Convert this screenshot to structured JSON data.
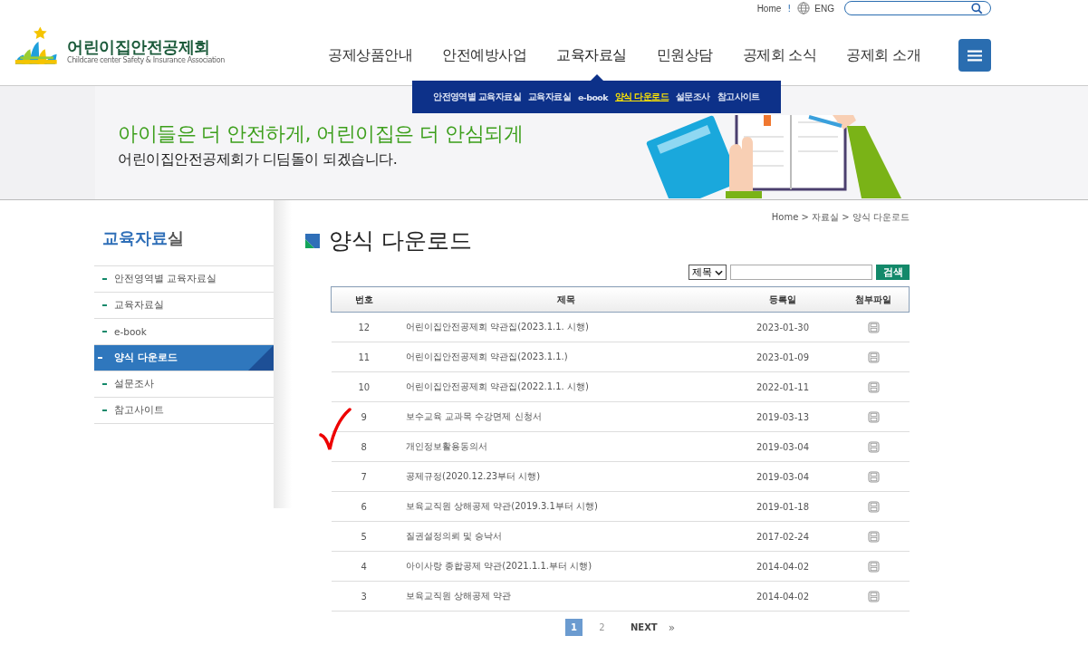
{
  "utility": {
    "home": "Home",
    "separator": "!",
    "language": "ENG"
  },
  "logo": {
    "name": "어린이집안전공제회",
    "subtitle": "Childcare center Safety & Insurance Association"
  },
  "nav": [
    {
      "label": "공제상품안내",
      "selected": false
    },
    {
      "label": "안전예방사업",
      "selected": false
    },
    {
      "label": "교육자료실",
      "selected": true
    },
    {
      "label": "민원상담",
      "selected": false
    },
    {
      "label": "공제회 소식",
      "selected": false
    },
    {
      "label": "공제회 소개",
      "selected": false
    }
  ],
  "submenu": [
    {
      "label": "안전영역별 교육자료실",
      "selected": false
    },
    {
      "label": "교육자료실",
      "selected": false
    },
    {
      "label": "e-book",
      "selected": false
    },
    {
      "label": "양식 다운로드",
      "selected": true
    },
    {
      "label": "설문조사",
      "selected": false
    },
    {
      "label": "참고사이트",
      "selected": false
    }
  ],
  "banner": {
    "headline": "아이들은 더 안전하게, 어린이집은 더 안심되게",
    "subline": "어린이집안전공제회가 디딤돌이 되겠습니다."
  },
  "sidebar": {
    "title_main": "교육자료",
    "title_suffix": "실",
    "items": [
      {
        "label": "안전영역별 교육자료실",
        "selected": false
      },
      {
        "label": "교육자료실",
        "selected": false
      },
      {
        "label": "e-book",
        "selected": false
      },
      {
        "label": "양식 다운로드",
        "selected": true
      },
      {
        "label": "설문조사",
        "selected": false
      },
      {
        "label": "참고사이트",
        "selected": false
      }
    ]
  },
  "breadcrumb": "Home > 자료실 > 양식 다운로드",
  "page_title": "양식 다운로드",
  "search": {
    "field": "제목",
    "button": "검색"
  },
  "table": {
    "columns": [
      "번호",
      "제목",
      "등록일",
      "첨부파일"
    ],
    "rows": [
      {
        "number": "12",
        "title": "어린이집안전공제회 약관집(2023.1.1. 시행)",
        "date": "2023-01-30"
      },
      {
        "number": "11",
        "title": "어린이집안전공제회 약관집(2023.1.1.)",
        "date": "2023-01-09"
      },
      {
        "number": "10",
        "title": "어린이집안전공제회 약관집(2022.1.1. 시행)",
        "date": "2022-01-11"
      },
      {
        "number": "9",
        "title": "보수교육 교과목 수강면제 신청서",
        "date": "2019-03-13"
      },
      {
        "number": "8",
        "title": "개인정보활용동의서",
        "date": "2019-03-04"
      },
      {
        "number": "7",
        "title": "공제규정(2020.12.23부터 시행)",
        "date": "2019-03-04"
      },
      {
        "number": "6",
        "title": "보육교직원 상해공제 약관(2019.3.1부터 시행)",
        "date": "2019-01-18"
      },
      {
        "number": "5",
        "title": "질권설정의뢰 및 승낙서",
        "date": "2017-02-24"
      },
      {
        "number": "4",
        "title": "아이사랑 종합공제 약관(2021.1.1.부터 시행)",
        "date": "2014-04-02"
      },
      {
        "number": "3",
        "title": "보육교직원 상해공제 약관",
        "date": "2014-04-02"
      }
    ]
  },
  "pagination": {
    "pages": [
      {
        "label": "1",
        "selected": true
      },
      {
        "label": "2",
        "selected": false
      }
    ],
    "next": "NEXT",
    "last": "»"
  }
}
